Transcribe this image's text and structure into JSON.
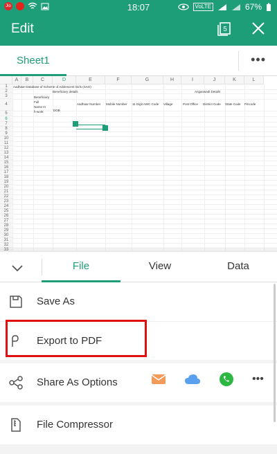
{
  "status": {
    "time": "18:07",
    "battery": "67%",
    "volte": "VoLTE",
    "jio": "Jio"
  },
  "app": {
    "title": "Edit",
    "window_count": "5"
  },
  "sheets": {
    "active": "Sheet1",
    "more": "•••"
  },
  "grid": {
    "columns": [
      "A",
      "B",
      "C",
      "D",
      "E",
      "F",
      "G",
      "H",
      "I",
      "J",
      "K",
      "L"
    ],
    "rows": [
      "1",
      "2",
      "3",
      "4",
      "5",
      "6",
      "7",
      "8",
      "9",
      "10",
      "11",
      "12",
      "13",
      "14",
      "15",
      "16",
      "17",
      "18",
      "19",
      "20",
      "21",
      "22",
      "23",
      "24",
      "25",
      "26",
      "27",
      "28",
      "29",
      "30",
      "31",
      "32",
      "33"
    ],
    "cells": {
      "a1": "Aadhaar Database of Scheme of Adolescent Girls (SAG)",
      "beneficiary": "Beneficiary details",
      "anganwadi": "Anganwadi Details",
      "b3": "Beneficiary Full Name In Mo",
      "b3_lines": [
        "Beneficiary",
        "Full",
        "Name In",
        "h-work"
      ],
      "dob": "DOB",
      "aadhaar": "Aadhaar Number",
      "mobile": "Mobile Number",
      "awc": "11 Digit AWC Code",
      "village": "Village",
      "post": "Post Office",
      "district": "District Code",
      "state": "State Code",
      "pincode": "Pincode"
    }
  },
  "panel": {
    "tabs": [
      "File",
      "View",
      "Data"
    ],
    "active_tab": "File",
    "items": {
      "save_as": "Save As",
      "export_pdf": "Export to PDF",
      "share": "Share As Options",
      "compressor": "File Compressor"
    },
    "share_more": "•••"
  },
  "colors": {
    "accent": "#1e9e78",
    "highlight": "#e01010"
  }
}
